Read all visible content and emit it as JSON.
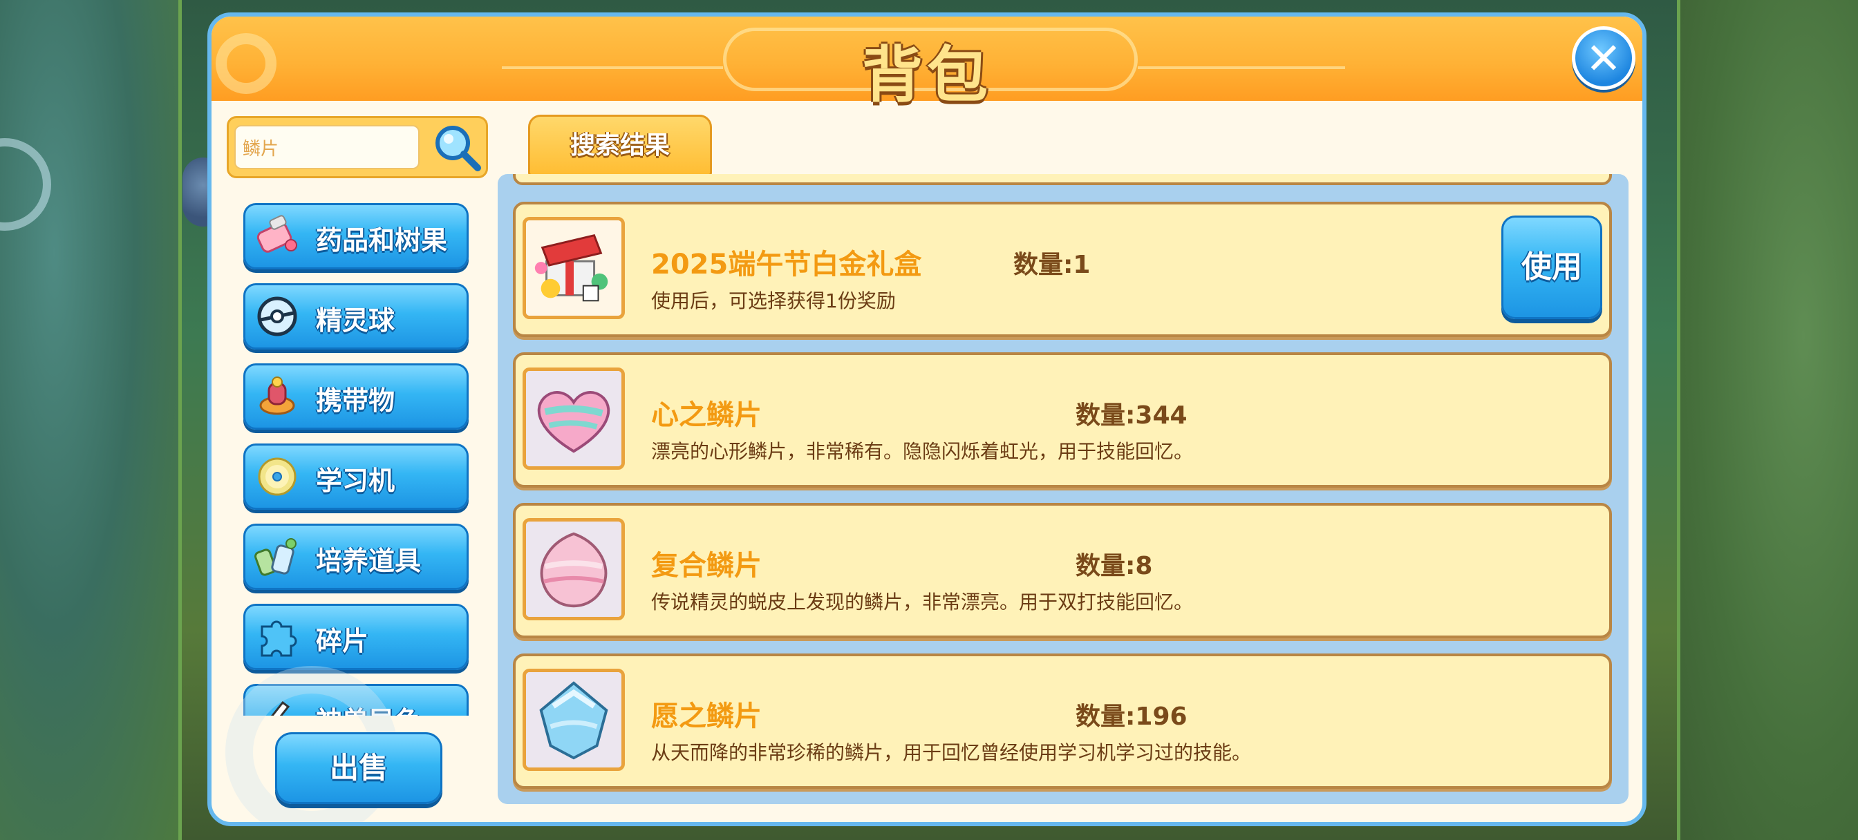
{
  "window": {
    "title": "背包",
    "close_icon": "close-icon"
  },
  "search": {
    "value": "鳞片",
    "button_icon": "magnifier-icon"
  },
  "sidebar": {
    "items": [
      {
        "label": "药品和树果",
        "icon": "medicine-icon"
      },
      {
        "label": "精灵球",
        "icon": "pokeball-icon"
      },
      {
        "label": "携带物",
        "icon": "held-item-icon"
      },
      {
        "label": "学习机",
        "icon": "disc-icon"
      },
      {
        "label": "培养道具",
        "icon": "training-item-icon"
      },
      {
        "label": "碎片",
        "icon": "puzzle-piece-icon"
      },
      {
        "label": "神兽异色",
        "icon": "legendary-shiny-icon"
      }
    ],
    "sell_label": "出售"
  },
  "tabs": {
    "active_label": "搜索结果"
  },
  "items": [
    {
      "name": "2025端午节白金礼盒",
      "qty": "数量:1",
      "desc": "使用后，可选择获得1份奖励",
      "icon": "gift-box-icon",
      "use_label": "使用"
    },
    {
      "name": "心之鳞片",
      "qty": "数量:344",
      "desc": "漂亮的心形鳞片，非常稀有。隐隐闪烁着虹光，用于技能回忆。",
      "icon": "heart-scale-icon"
    },
    {
      "name": "复合鳞片",
      "qty": "数量:8",
      "desc": "传说精灵的蜕皮上发现的鳞片，非常漂亮。用于双打技能回忆。",
      "icon": "composite-scale-icon"
    },
    {
      "name": "愿之鳞片",
      "qty": "数量:196",
      "desc": "从天而降的非常珍稀的鳞片，用于回忆曾经使用学习机学习过的技能。",
      "icon": "wish-scale-icon"
    }
  ],
  "colors": {
    "header_orange": "#ffb236",
    "button_blue": "#1d95e4",
    "item_name_orange": "#f39a12",
    "panel_border_blue": "#66b8ee"
  }
}
